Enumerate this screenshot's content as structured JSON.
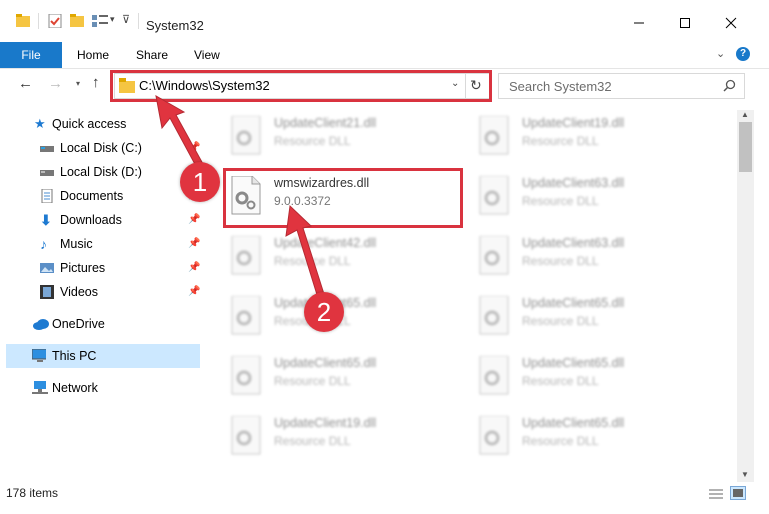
{
  "window": {
    "title": "System32",
    "accent": "#1979ca",
    "minimize_icon": "minimize-icon",
    "maximize_icon": "maximize-icon",
    "close_icon": "close-icon"
  },
  "ribbon": {
    "tabs": [
      "File",
      "Home",
      "Share",
      "View"
    ]
  },
  "address": {
    "path": "C:\\Windows\\System32",
    "search_placeholder": "Search System32"
  },
  "sidebar": {
    "items": [
      {
        "label": "Quick access",
        "icon": "star-icon"
      },
      {
        "label": "Local Disk (C:)",
        "icon": "drive-icon"
      },
      {
        "label": "Local Disk (D:)",
        "icon": "drive-icon"
      },
      {
        "label": "Documents",
        "icon": "documents-icon"
      },
      {
        "label": "Downloads",
        "icon": "download-icon"
      },
      {
        "label": "Music",
        "icon": "music-icon"
      },
      {
        "label": "Pictures",
        "icon": "pictures-icon"
      },
      {
        "label": "Videos",
        "icon": "videos-icon"
      },
      {
        "label": "OneDrive",
        "icon": "cloud-icon"
      },
      {
        "label": "This PC",
        "icon": "computer-icon"
      },
      {
        "label": "Network",
        "icon": "network-icon"
      }
    ]
  },
  "files": {
    "type_label": "Resource DLL",
    "highlighted": {
      "name": "wmswizardres.dll",
      "version": "9.0.0.3372"
    },
    "left_column": [
      "UpdateClient21.dll",
      "UpdateClient42.dll",
      "UpdateClient65.dll",
      "UpdateClient65.dll",
      "UpdateClient19.dll"
    ],
    "right_column": [
      "UpdateClient19.dll",
      "UpdateClient63.dll",
      "UpdateClient63.dll",
      "UpdateClient65.dll",
      "UpdateClient65.dll",
      "UpdateClient65.dll"
    ]
  },
  "status": {
    "item_count": "178 items"
  },
  "annotations": {
    "step1": "1",
    "step2": "2",
    "color": "#e0343f"
  }
}
